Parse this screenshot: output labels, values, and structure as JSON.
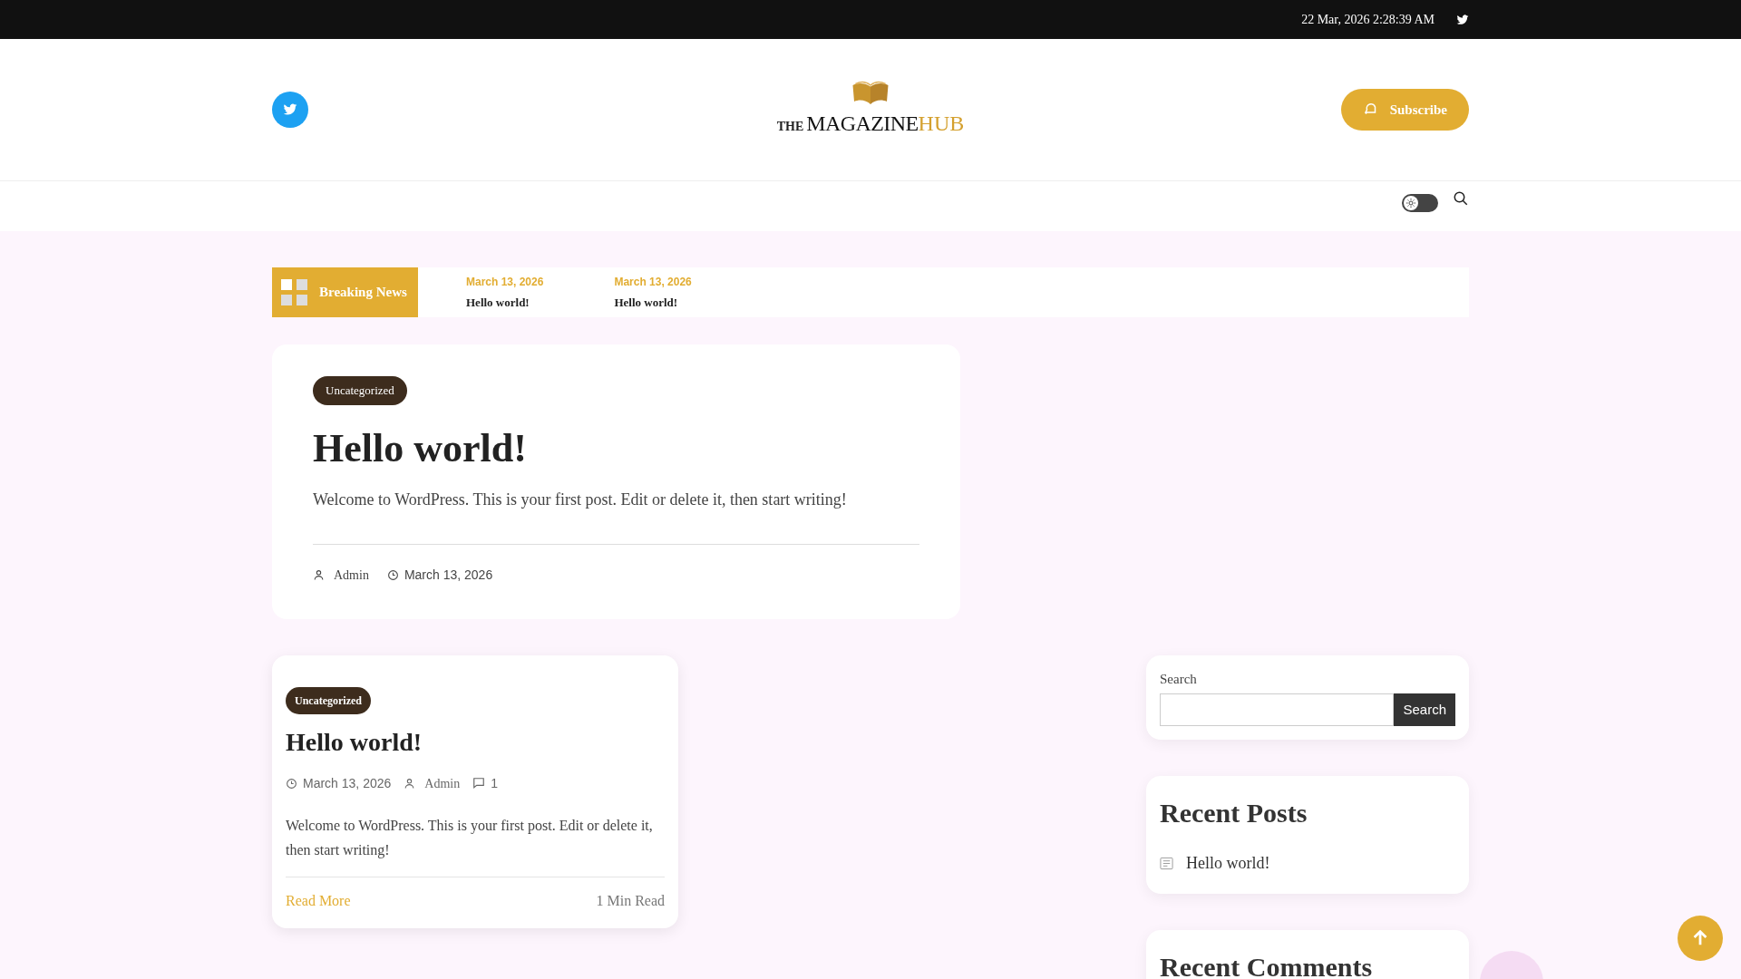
{
  "top_bar": {
    "datetime": "22 Mar, 2026 2:28:39 AM"
  },
  "header": {
    "logo": {
      "prefix": "THE",
      "main": "MAGAZINE",
      "accent": "HUB"
    },
    "subscribe_button": "Subscribe"
  },
  "nav": {
    "dark_mode": false
  },
  "breaking_news": {
    "label": "Breaking News",
    "items": [
      {
        "date": "March 13, 2026",
        "title": "Hello world!"
      },
      {
        "date": "March 13, 2026",
        "title": "Hello world!"
      }
    ]
  },
  "featured_post": {
    "category": "Uncategorized",
    "title": "Hello world!",
    "excerpt": "Welcome to WordPress. This is your first post. Edit or delete it, then start writing!",
    "author": "Admin",
    "date": "March 13, 2026"
  },
  "posts": [
    {
      "category": "Uncategorized",
      "title": "Hello world!",
      "date": "March 13, 2026",
      "author": "Admin",
      "comments": "1",
      "excerpt": "Welcome to WordPress. This is your first post. Edit or delete it, then start writing!",
      "read_more": "Read More",
      "read_time": "1 Min Read"
    }
  ],
  "sidebar": {
    "search": {
      "label": "Search",
      "button": "Search"
    },
    "recent_posts": {
      "title": "Recent Posts",
      "items": [
        "Hello world!"
      ]
    },
    "recent_comments": {
      "title": "Recent Comments"
    }
  }
}
